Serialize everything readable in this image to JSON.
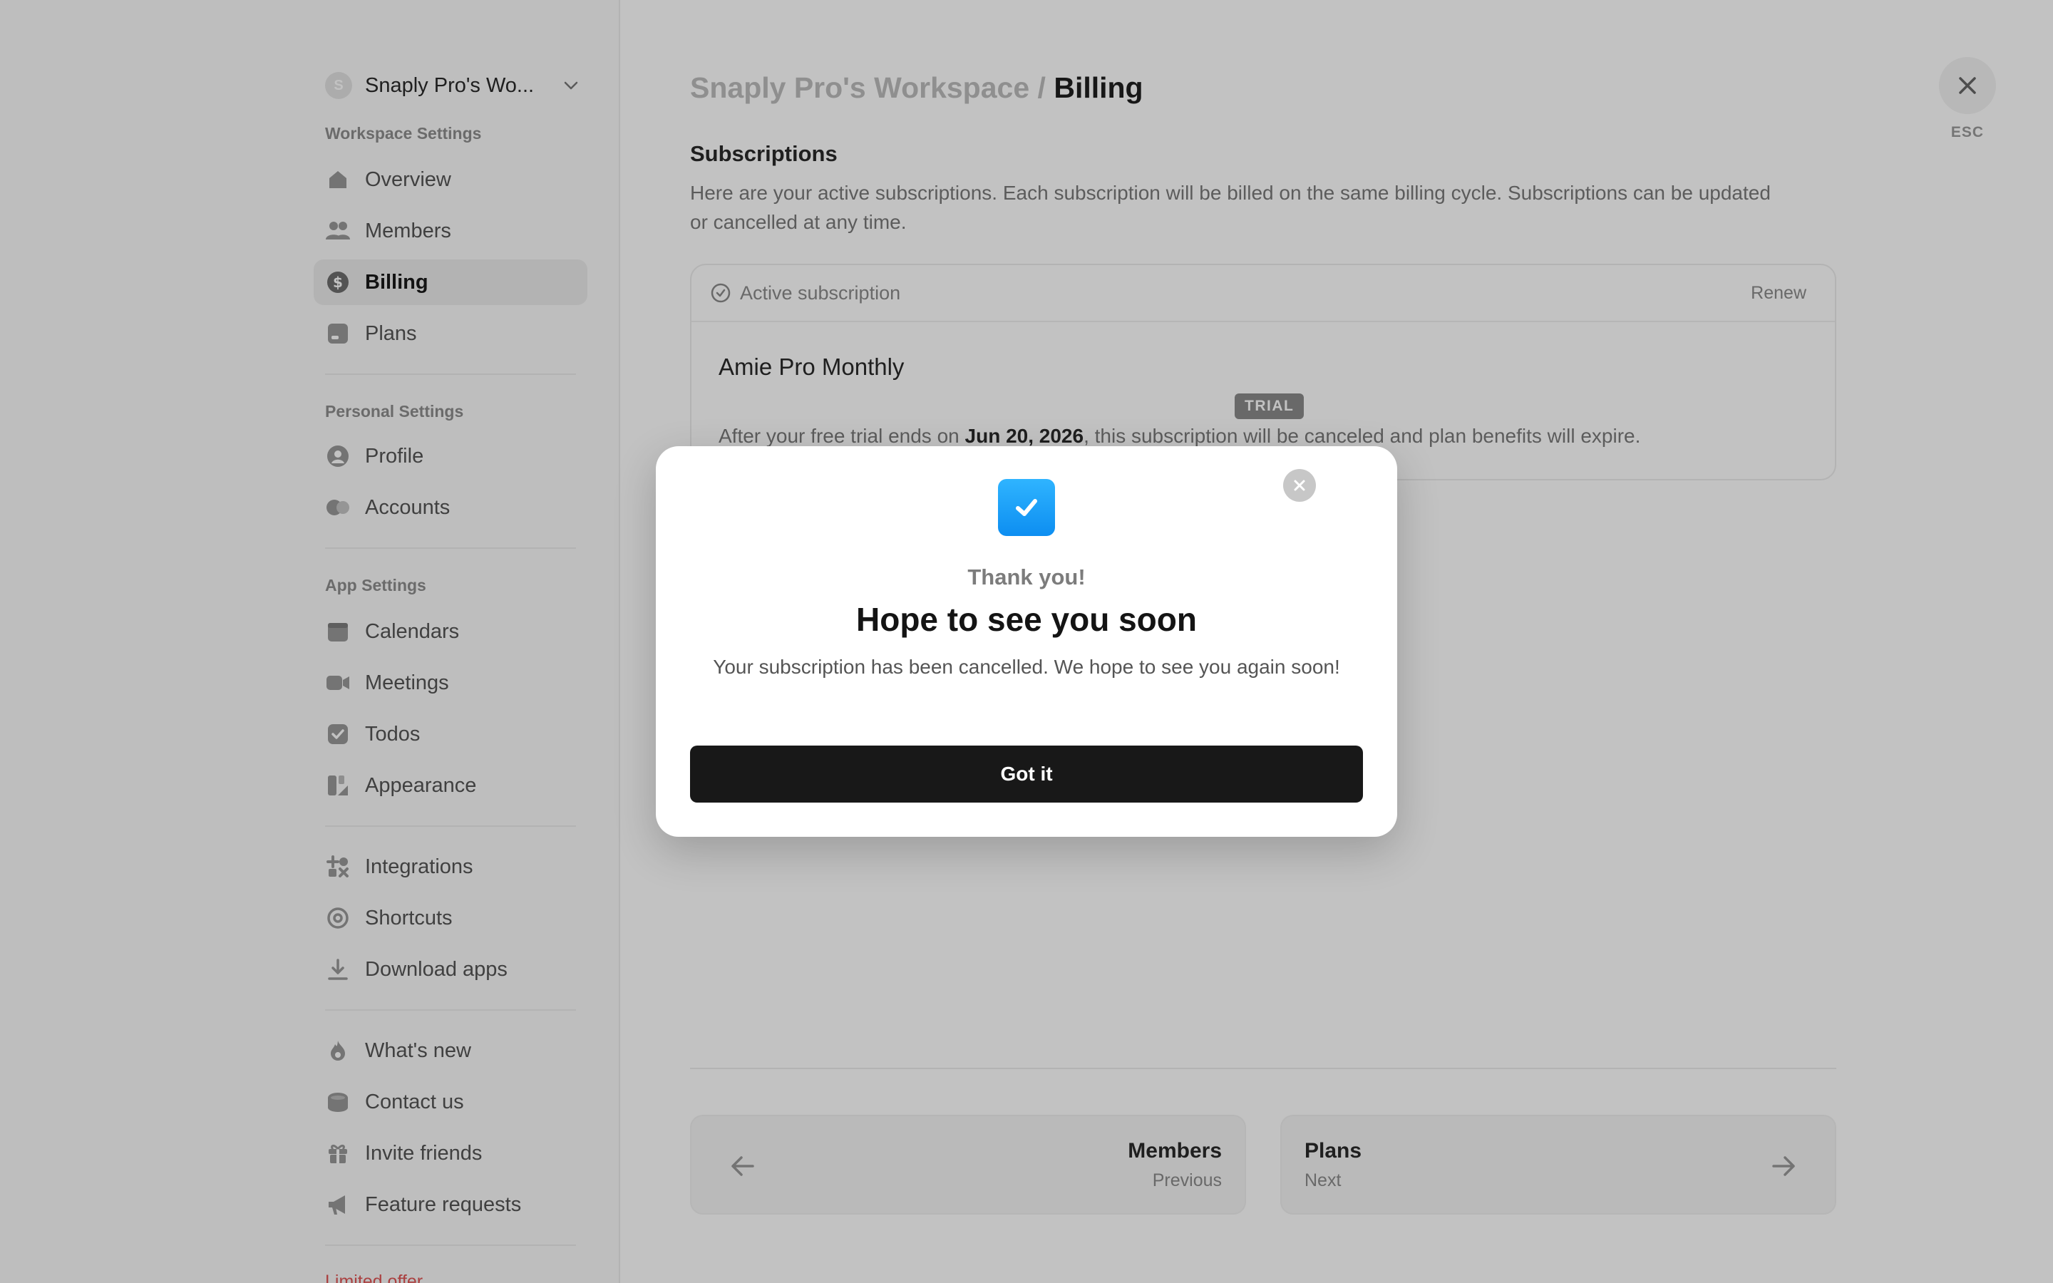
{
  "sidebar": {
    "workspace": {
      "avatar_letter": "S",
      "name": "Snaply Pro's Wo..."
    },
    "sections": {
      "workspace_settings": "Workspace Settings",
      "personal_settings": "Personal Settings",
      "app_settings": "App Settings"
    },
    "items": {
      "overview": "Overview",
      "members": "Members",
      "billing": "Billing",
      "plans": "Plans",
      "profile": "Profile",
      "accounts": "Accounts",
      "calendars": "Calendars",
      "meetings": "Meetings",
      "todos": "Todos",
      "appearance": "Appearance",
      "integrations": "Integrations",
      "shortcuts": "Shortcuts",
      "download_apps": "Download apps",
      "whats_new": "What's new",
      "contact_us": "Contact us",
      "invite_friends": "Invite friends",
      "feature_requests": "Feature requests"
    },
    "active_item": "billing",
    "promo_text": "Limited offer"
  },
  "header": {
    "workspace": "Snaply Pro's Workspace",
    "separator": "/",
    "page": "Billing",
    "esc_label": "ESC"
  },
  "subscriptions": {
    "title": "Subscriptions",
    "description": "Here are your active subscriptions. Each subscription will be billed on the same billing cycle. Subscriptions can be updated or cancelled at any time.",
    "card": {
      "status": "Active subscription",
      "renew": "Renew",
      "plan_name": "Amie Pro Monthly",
      "badge": "TRIAL",
      "text_before": "After your free trial ends on ",
      "date": "Jun 20, 2026",
      "text_after": ", this subscription will be canceled and plan benefits will expire."
    }
  },
  "pager": {
    "prev": {
      "title": "Members",
      "sub": "Previous"
    },
    "next": {
      "title": "Plans",
      "sub": "Next"
    }
  },
  "modal": {
    "kicker": "Thank you!",
    "title": "Hope to see you soon",
    "body": "Your subscription has been cancelled. We hope to see you again soon!",
    "button": "Got it"
  },
  "colors": {
    "accent_blue": "#1a9ff6",
    "button_dark": "#181818",
    "overlay": "rgba(0,0,0,0.24)"
  }
}
